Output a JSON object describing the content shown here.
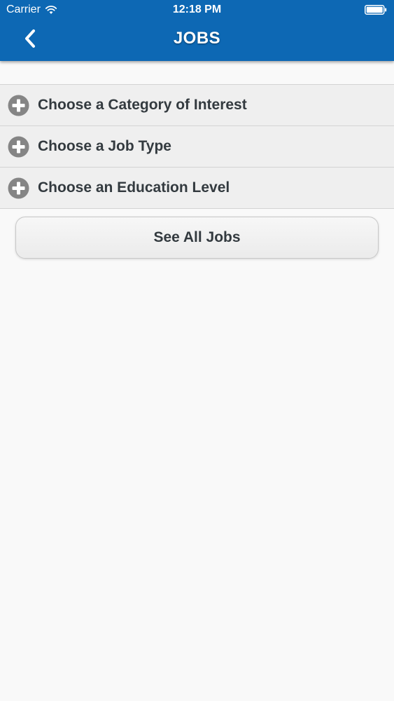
{
  "status_bar": {
    "carrier": "Carrier",
    "time": "12:18 PM",
    "wifi_icon": "wifi-icon",
    "battery_icon": "battery-icon"
  },
  "nav": {
    "title": "JOBS",
    "back_icon": "chevron-left-icon"
  },
  "filters": [
    {
      "label": "Choose a Category of Interest",
      "icon": "plus-circle-icon"
    },
    {
      "label": "Choose a Job Type",
      "icon": "plus-circle-icon"
    },
    {
      "label": "Choose an Education Level",
      "icon": "plus-circle-icon"
    }
  ],
  "see_all_button": {
    "label": "See All Jobs"
  },
  "colors": {
    "header_bg": "#0d68b4",
    "list_bg": "#efefef",
    "page_bg": "#f9f9f9",
    "icon_gray": "#858585",
    "text_dark": "#333a3f"
  }
}
